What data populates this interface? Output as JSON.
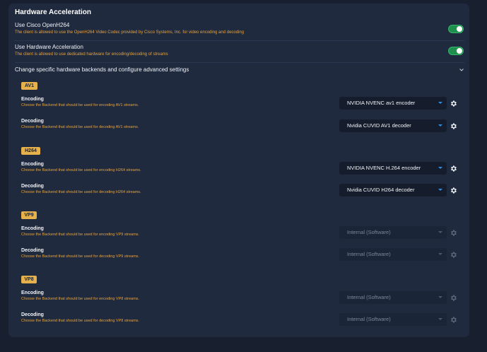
{
  "panel": {
    "title": "Hardware Acceleration"
  },
  "settings": [
    {
      "title": "Use Cisco OpenH264",
      "desc": "The client is allowed to use the OpenH264 Video Codec provided by Cisco Systems, Inc. for video encoding and decoding",
      "enabled": true
    },
    {
      "title": "Use Hardware Acceleration",
      "desc": "The client is allowed to use dedicated hardware for encoding/decoding of streams",
      "enabled": true
    }
  ],
  "advanced": {
    "label": "Change specific hardware backends and configure advanced settings",
    "expanded": true
  },
  "codecs": [
    {
      "name": "AV1",
      "encoding": {
        "title": "Encoding",
        "desc": "Choose the Backend that should be used for encoding AV1 streams.",
        "value": "NVIDIA NVENC av1 encoder",
        "enabled": true
      },
      "decoding": {
        "title": "Decoding",
        "desc": "Choose the Backend that should be used for decoding AV1 streams.",
        "value": "Nvidia CUVID AV1 decoder",
        "enabled": true
      }
    },
    {
      "name": "H264",
      "encoding": {
        "title": "Encoding",
        "desc": "Choose the Backend that should be used for encoding H264 streams.",
        "value": "NVIDIA NVENC H.264 encoder",
        "enabled": true
      },
      "decoding": {
        "title": "Decoding",
        "desc": "Choose the Backend that should be used for decoding H264 streams.",
        "value": "Nvidia CUVID H264 decoder",
        "enabled": true
      }
    },
    {
      "name": "VP9",
      "encoding": {
        "title": "Encoding",
        "desc": "Choose the Backend that should be used for encoding VP9 streams.",
        "value": "Internal (Software)",
        "enabled": false
      },
      "decoding": {
        "title": "Decoding",
        "desc": "Choose the Backend that should be used for decoding VP9 streams.",
        "value": "Internal (Software)",
        "enabled": false
      }
    },
    {
      "name": "VP8",
      "encoding": {
        "title": "Encoding",
        "desc": "Choose the Backend that should be used for encoding VP8 streams.",
        "value": "Internal (Software)",
        "enabled": false
      },
      "decoding": {
        "title": "Decoding",
        "desc": "Choose the Backend that should be used for decoding VP8 streams.",
        "value": "Internal (Software)",
        "enabled": false
      }
    }
  ],
  "colors": {
    "background": "#18202f",
    "panel": "#1f2a3f",
    "accent_orange": "#e6a33e",
    "badge": "#e6b04a",
    "toggle_on": "#1f8f4e",
    "select_bg": "#151d2c",
    "select_arrow": "#2e8de6",
    "disabled_text": "#7d879b"
  },
  "icons": {
    "toggle": "toggle-switch",
    "expand": "chevron-down-icon",
    "dropdown": "caret-down-icon",
    "settings": "gear-icon"
  }
}
